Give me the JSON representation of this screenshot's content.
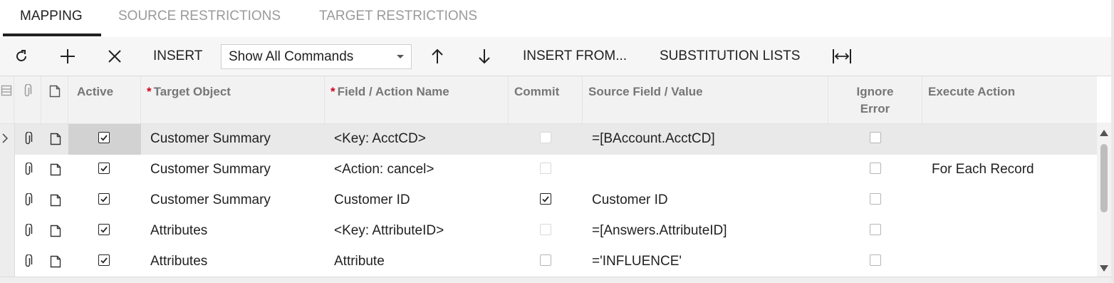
{
  "tabs": [
    {
      "label": "MAPPING",
      "active": true
    },
    {
      "label": "SOURCE RESTRICTIONS",
      "active": false
    },
    {
      "label": "TARGET RESTRICTIONS",
      "active": false
    }
  ],
  "toolbar": {
    "refresh_icon": "refresh-icon",
    "add_icon": "plus-icon",
    "delete_icon": "close-icon",
    "insert_label": "INSERT",
    "command_select_value": "Show All Commands",
    "move_up_icon": "arrow-up-icon",
    "move_down_icon": "arrow-down-icon",
    "insert_from_label": "INSERT FROM...",
    "substitution_lists_label": "SUBSTITUTION LISTS",
    "fit_columns_icon": "fit-columns-icon"
  },
  "grid": {
    "columns": {
      "active": "Active",
      "target_object": "Target Object",
      "field_action": "Field / Action Name",
      "commit": "Commit",
      "source_field": "Source Field / Value",
      "ignore_error": "Ignore Error",
      "execute_action": "Execute Action"
    },
    "rows": [
      {
        "active": true,
        "target_object": "Customer Summary",
        "field_action": "<Key: AcctCD>",
        "commit": false,
        "commit_enabled": false,
        "source_field": "=[BAccount.AcctCD]",
        "ignore_error": false,
        "execute_action": "",
        "selected": true
      },
      {
        "active": true,
        "target_object": "Customer Summary",
        "field_action": "<Action: cancel>",
        "commit": false,
        "commit_enabled": false,
        "source_field": "",
        "ignore_error": false,
        "execute_action": "For Each Record",
        "selected": false
      },
      {
        "active": true,
        "target_object": "Customer Summary",
        "field_action": "Customer ID",
        "commit": true,
        "commit_enabled": true,
        "source_field": "Customer ID",
        "ignore_error": false,
        "execute_action": "",
        "selected": false
      },
      {
        "active": true,
        "target_object": "Attributes",
        "field_action": "<Key: AttributeID>",
        "commit": false,
        "commit_enabled": false,
        "source_field": "=[Answers.AttributeID]",
        "ignore_error": false,
        "execute_action": "",
        "selected": false
      },
      {
        "active": true,
        "target_object": "Attributes",
        "field_action": "Attribute",
        "commit": false,
        "commit_enabled": true,
        "source_field": "='INFLUENCE'",
        "ignore_error": false,
        "execute_action": "",
        "selected": false
      }
    ]
  },
  "colors": {
    "accent": "#212121",
    "required": "#d0021b",
    "header_bg": "#f2f2f2",
    "selected_row_bg": "#e9e9e9"
  }
}
